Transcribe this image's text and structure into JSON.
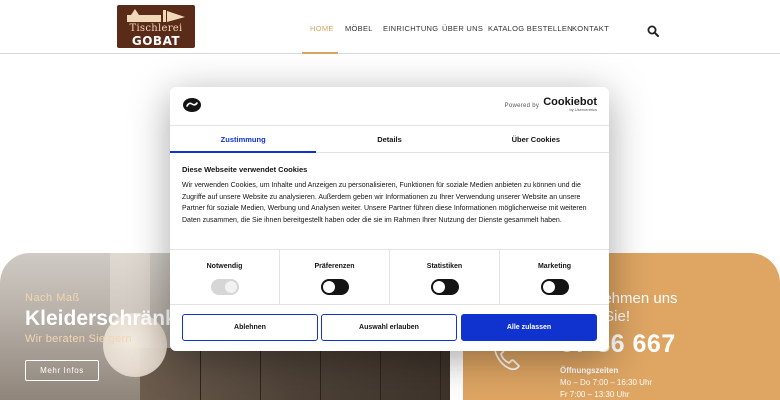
{
  "logo": {
    "line1": "Tischlerei",
    "line2": "GOBAT"
  },
  "nav": {
    "items": [
      {
        "label": "HOME",
        "active": true
      },
      {
        "label": "MÖBEL",
        "active": false
      },
      {
        "label": "EINRICHTUNG",
        "active": false
      },
      {
        "label": "ÜBER UNS",
        "active": false
      },
      {
        "label": "KATALOG BESTELLEN",
        "active": false
      },
      {
        "label": "KONTAKT",
        "active": false
      }
    ],
    "search_icon": "search-icon"
  },
  "hero": {
    "subtitle": "Nach Maß",
    "title": "Kleiderschränk",
    "tagline": "Wir beraten Sie gern",
    "button": "Mehr Infos"
  },
  "contact": {
    "title_line1": "nehmen uns",
    "title_line2": "r Sie!",
    "phone": "07 86 667",
    "hours_title": "Öffnungszeiten",
    "hours_line1": "Mo – Do 7:00 – 16:30 Uhr",
    "hours_line2": "Fr 7:00 – 13:30 Uhr"
  },
  "cookie": {
    "powered_by": "Powered by",
    "brand": "Cookiebot",
    "brand_sub": "by Usercentrics",
    "tabs": [
      "Zustimmung",
      "Details",
      "Über Cookies"
    ],
    "heading": "Diese Webseite verwendet Cookies",
    "body": "Wir verwenden Cookies, um Inhalte und Anzeigen zu personalisieren, Funktionen für soziale Medien anbieten zu können und die Zugriffe auf unsere Website zu analysieren. Außerdem geben wir Informationen zu Ihrer Verwendung unserer Website an unsere Partner für soziale Medien, Werbung und Analysen weiter. Unsere Partner führen diese Informationen möglicherweise mit weiteren Daten zusammen, die Sie ihnen bereitgestellt haben oder die sie im Rahmen Ihrer Nutzung der Dienste gesammelt haben.",
    "categories": [
      {
        "label": "Notwendig",
        "state": "disabled"
      },
      {
        "label": "Präferenzen",
        "state": "off"
      },
      {
        "label": "Statistiken",
        "state": "off"
      },
      {
        "label": "Marketing",
        "state": "off"
      }
    ],
    "buttons": {
      "deny": "Ablehnen",
      "allow_selection": "Auswahl erlauben",
      "allow_all": "Alle zulassen"
    }
  },
  "colors": {
    "accent": "#d9a464",
    "cookie_blue": "#1032cf",
    "contact_bg": "#dea563"
  }
}
